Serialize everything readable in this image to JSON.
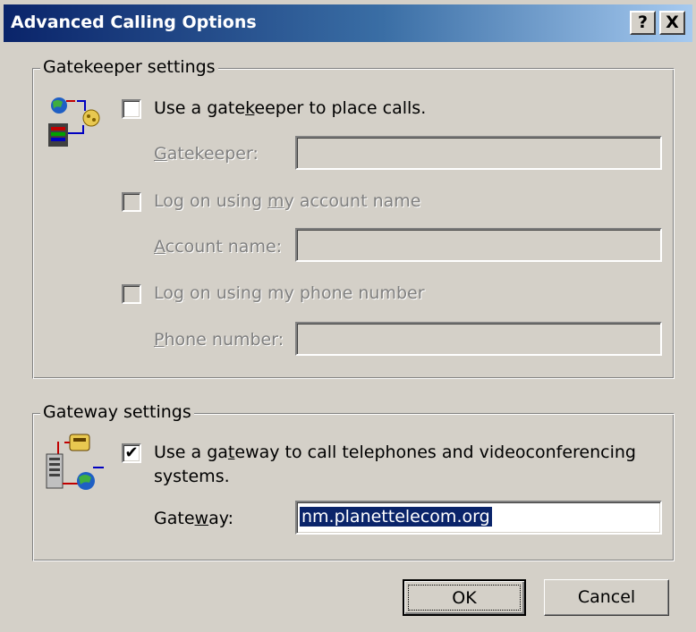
{
  "window": {
    "title": "Advanced Calling Options",
    "help_button": "?",
    "close_button": "X"
  },
  "gatekeeper": {
    "group_title": "Gatekeeper settings",
    "use_gatekeeper": {
      "pre": "Use a gate",
      "mnemonic": "k",
      "post": "eeper to place calls.",
      "checked": false
    },
    "gatekeeper_field": {
      "mnemonic": "G",
      "post": "atekeeper:",
      "value": ""
    },
    "logon_account": {
      "pre": "Log on using ",
      "mnemonic": "m",
      "post": "y account name",
      "checked": false
    },
    "account_field": {
      "mnemonic": "A",
      "post": "ccount name:",
      "value": ""
    },
    "logon_phone": {
      "pre": "Lo",
      "mnemonic": "g",
      "post": " on using my phone number",
      "checked": false
    },
    "phone_field": {
      "mnemonic": "P",
      "post": "hone number:",
      "value": ""
    }
  },
  "gateway": {
    "group_title": "Gateway settings",
    "use_gateway": {
      "pre": "Use a ga",
      "mnemonic": "t",
      "post": "eway to call telephones and videoconferencing",
      "line2": "systems.",
      "checked": true,
      "check_glyph": "✔"
    },
    "gateway_field": {
      "pre": "Gate",
      "mnemonic": "w",
      "post": "ay:",
      "value": "nm.planettelecom.org"
    }
  },
  "buttons": {
    "ok": "OK",
    "cancel": "Cancel"
  },
  "colors": {
    "face": "#d4d0c8",
    "titlebar_start": "#0a246a",
    "titlebar_end": "#a6caf0",
    "selection": "#0a246a"
  }
}
